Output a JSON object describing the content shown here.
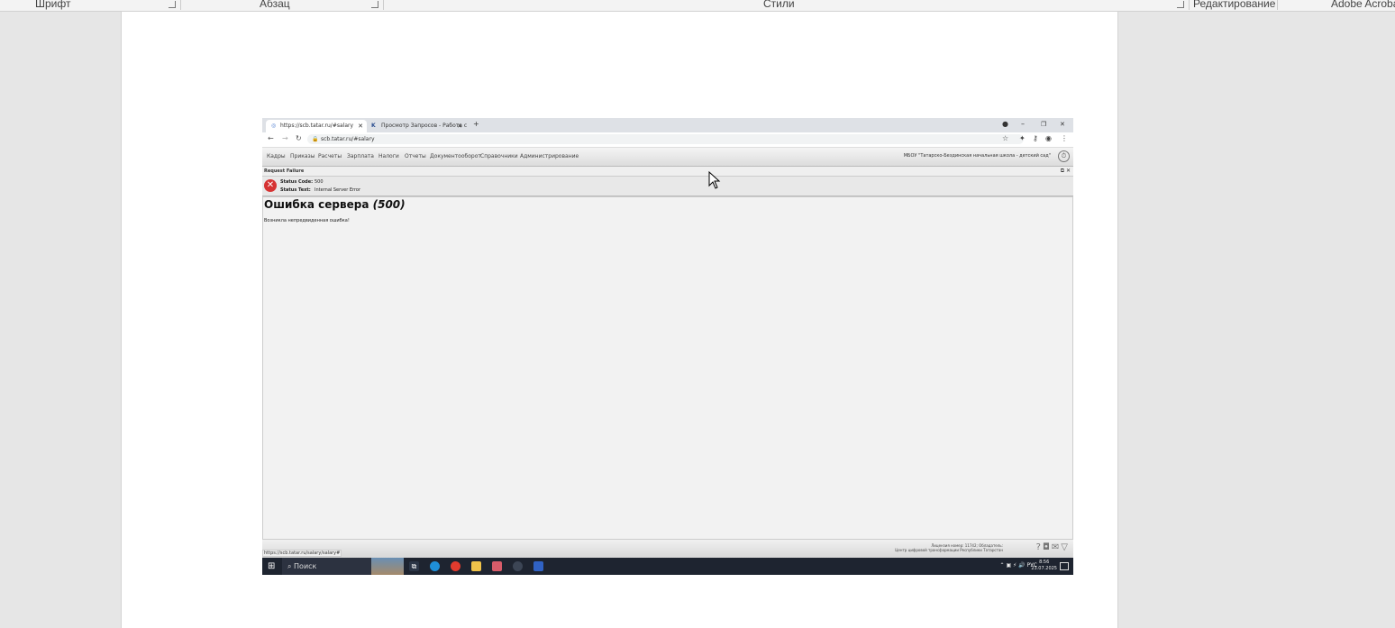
{
  "ribbon": {
    "groups": [
      "Шрифт",
      "Абзац",
      "Стили",
      "Редактирование",
      "Adobe Acroba"
    ]
  },
  "browser": {
    "tabs": [
      {
        "title": "https://scb.tatar.ru/#salary"
      },
      {
        "title": "Просмотр Запросов - Работа с"
      }
    ],
    "new_tab": "+",
    "window_controls": {
      "minimize": "–",
      "restore": "❐",
      "close": "✕"
    },
    "url": "scb.tatar.ru/#salary"
  },
  "app": {
    "menu": [
      "Кадры",
      "Приказы",
      "Расчеты",
      "Зарплата",
      "Налоги",
      "Отчеты",
      "Документооборот",
      "Справочники",
      "Администрирование"
    ],
    "organization": "МБОУ \"Татарско-Бездинская начальная школа - детский сад\"",
    "request_failure": {
      "title": "Request Failure",
      "status_code_label": "Status Code:",
      "status_code": "500",
      "status_text_label": "Status Text:",
      "status_text": "Internal Server Error"
    },
    "error": {
      "title": "Ошибка сервера",
      "code": "(500)",
      "message": "Возникла непредвиденная ошибка!"
    },
    "footer": {
      "license_line1": "Лицензия номер: 11742; Обладатель:",
      "license_line2": "Центр цифровой трансформации Республики Татарстан",
      "status_url": "https://scb.tatar.ru/salary/salary#"
    }
  },
  "taskbar": {
    "search_label": "Поиск",
    "language": "РУС",
    "time": "8:56",
    "date": "23.07.2025"
  }
}
